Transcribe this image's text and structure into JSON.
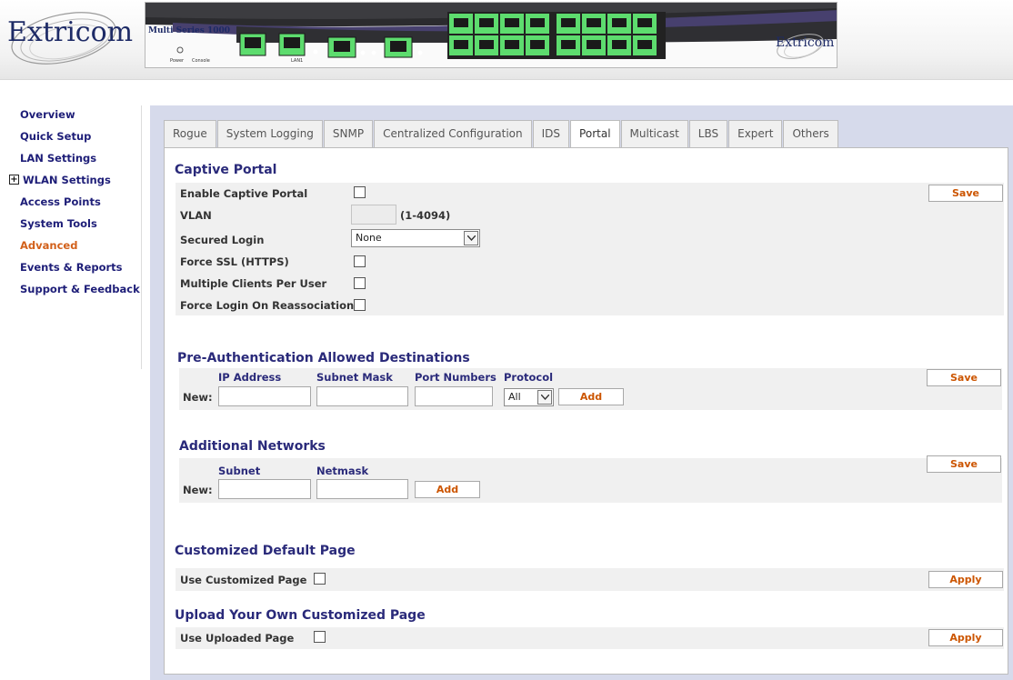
{
  "header": {
    "logo_text": "Extricom",
    "device_model": "Multi Series 1000",
    "device_logo": "Extricom",
    "power_label": "Power",
    "console_label": "Console",
    "lan1_label": "LAN1"
  },
  "sidebar": {
    "items": [
      {
        "label": "Overview"
      },
      {
        "label": "Quick Setup"
      },
      {
        "label": "LAN Settings"
      },
      {
        "label": "WLAN Settings",
        "expand_symbol": "+"
      },
      {
        "label": "Access Points"
      },
      {
        "label": "System Tools"
      },
      {
        "label": "Advanced",
        "active": true
      },
      {
        "label": "Events & Reports"
      },
      {
        "label": "Support & Feedback"
      }
    ]
  },
  "tabs": [
    {
      "label": "Rogue"
    },
    {
      "label": "System Logging"
    },
    {
      "label": "SNMP"
    },
    {
      "label": "Centralized Configuration"
    },
    {
      "label": "IDS"
    },
    {
      "label": "Portal",
      "active": true
    },
    {
      "label": "Multicast"
    },
    {
      "label": "LBS"
    },
    {
      "label": "Expert"
    },
    {
      "label": "Others"
    }
  ],
  "captive_portal": {
    "title": "Captive Portal",
    "enable_label": "Enable Captive Portal",
    "vlan_label": "VLAN",
    "vlan_value": "",
    "vlan_hint": "(1-4094)",
    "secured_login_label": "Secured Login",
    "secured_login_value": "None",
    "force_ssl_label": "Force SSL (HTTPS)",
    "multi_clients_label": "Multiple Clients Per User",
    "force_login_label": "Force Login On Reassociation",
    "save_label": "Save"
  },
  "pre_auth": {
    "title": "Pre-Authentication Allowed Destinations",
    "col_ip": "IP Address",
    "col_mask": "Subnet Mask",
    "col_ports": "Port Numbers",
    "col_protocol": "Protocol",
    "new_label": "New:",
    "protocol_value": "All",
    "add_label": "Add",
    "save_label": "Save"
  },
  "additional_networks": {
    "title": "Additional Networks",
    "col_subnet": "Subnet",
    "col_netmask": "Netmask",
    "new_label": "New:",
    "add_label": "Add",
    "save_label": "Save"
  },
  "custom_default": {
    "title": "Customized Default Page",
    "use_label": "Use Customized Page",
    "apply_label": "Apply"
  },
  "upload_custom": {
    "title": "Upload Your Own Customized Page",
    "use_label": "Use Uploaded Page",
    "apply_label": "Apply"
  },
  "colors": {
    "nav_text": "#1e1e78",
    "nav_active": "#d2601a",
    "section_title": "#2a2a7a",
    "button_text": "#cc5500",
    "panel_bg": "#d6daeb",
    "port_green": "#5ddc6e"
  }
}
